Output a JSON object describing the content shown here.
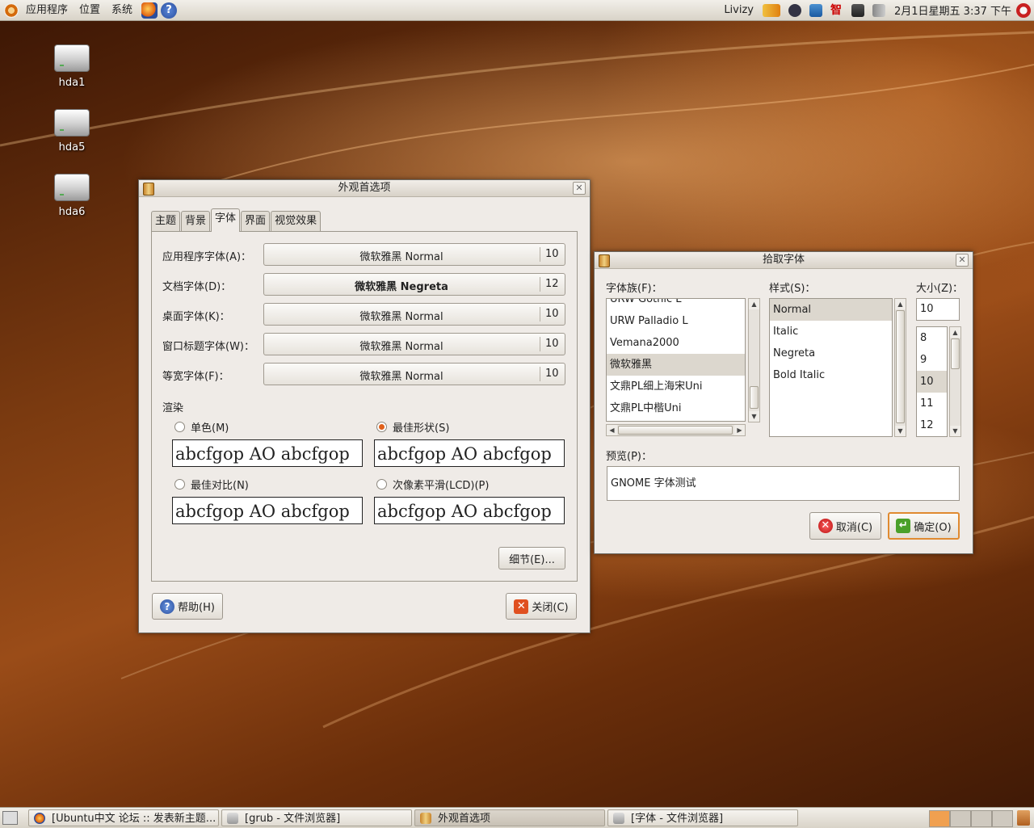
{
  "top_panel": {
    "menus": [
      "应用程序",
      "位置",
      "系统"
    ],
    "user": "Livizy",
    "clock": "2月1日星期五  3:37 下午",
    "tray_icons": [
      "network-icon",
      "bluetooth-icon",
      "update-icon",
      "input-method-icon",
      "monitor-icon",
      "volume-icon"
    ]
  },
  "desktop_icons": [
    "hda1",
    "hda5",
    "hda6"
  ],
  "appearance_window": {
    "title": "外观首选项",
    "tabs": [
      "主题",
      "背景",
      "字体",
      "界面",
      "视觉效果"
    ],
    "active_tab": "字体",
    "font_rows": [
      {
        "label": "应用程序字体(A)：",
        "font": "微软雅黑 Normal",
        "size": "10",
        "bold": false
      },
      {
        "label": "文档字体(D)：",
        "font": "微软雅黑 Negreta",
        "size": "12",
        "bold": true
      },
      {
        "label": "桌面字体(K)：",
        "font": "微软雅黑 Normal",
        "size": "10",
        "bold": false
      },
      {
        "label": "窗口标题字体(W)：",
        "font": "微软雅黑 Normal",
        "size": "10",
        "bold": false
      },
      {
        "label": "等宽字体(F)：",
        "font": "微软雅黑 Normal",
        "size": "10",
        "bold": false
      }
    ],
    "rendering_title": "渲染",
    "rendering_options": [
      {
        "label": "单色(M)",
        "selected": false,
        "sample": "abcfgop AO abcfgop"
      },
      {
        "label": "最佳形状(S)",
        "selected": true,
        "sample": "abcfgop AO abcfgop"
      },
      {
        "label": "最佳对比(N)",
        "selected": false,
        "sample": "abcfgop AO abcfgop"
      },
      {
        "label": "次像素平滑(LCD)(P)",
        "selected": false,
        "sample": "abcfgop AO abcfgop"
      }
    ],
    "details_button": "细节(E)...",
    "help_button": "帮助(H)",
    "close_button": "关闭(C)"
  },
  "font_picker": {
    "title": "拾取字体",
    "family_label": "字体族(F)：",
    "style_label": "样式(S)：",
    "size_label": "大小(Z)：",
    "families": [
      "URW Gothic L",
      "URW Palladio L",
      "Vemana2000",
      "微软雅黑",
      "文鼎PL细上海宋Uni",
      "文鼎PL中楷Uni"
    ],
    "selected_family": "微软雅黑",
    "styles": [
      "Normal",
      "Italic",
      "Negreta",
      "Bold Italic"
    ],
    "selected_style": "Normal",
    "size_value": "10",
    "sizes": [
      "8",
      "9",
      "10",
      "11",
      "12"
    ],
    "selected_size": "10",
    "preview_label": "预览(P)：",
    "preview_text": "GNOME 字体测试",
    "cancel_button": "取消(C)",
    "ok_button": "确定(O)"
  },
  "taskbar": {
    "tasks": [
      "[Ubuntu中文 论坛 :: 发表新主题...",
      "[grub - 文件浏览器]",
      "外观首选项",
      "[字体 - 文件浏览器]"
    ]
  }
}
